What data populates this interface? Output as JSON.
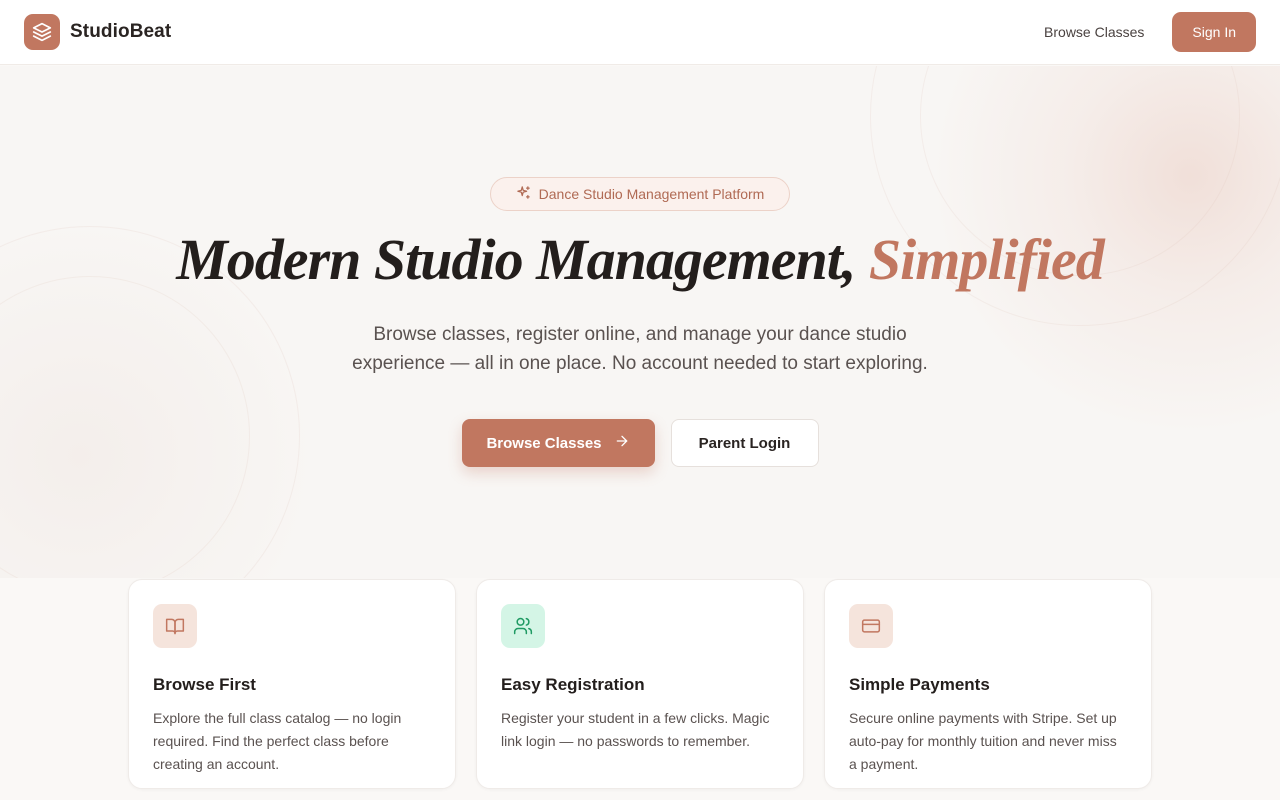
{
  "header": {
    "brand_name": "StudioBeat",
    "nav_browse": "Browse Classes",
    "sign_in": "Sign In"
  },
  "hero": {
    "badge": "Dance Studio Management Platform",
    "title_main": "Modern Studio Management,",
    "title_accent": "Simplified",
    "subtitle": "Browse classes, register online, and manage your dance studio experience — all in one place. No account needed to start exploring.",
    "primary_button": "Browse Classes",
    "secondary_button": "Parent Login"
  },
  "features": [
    {
      "icon": "book-open-icon",
      "title": "Browse First",
      "text": "Explore the full class catalog — no login required. Find the perfect class before creating an account."
    },
    {
      "icon": "users-icon",
      "title": "Easy Registration",
      "text": "Register your student in a few clicks. Magic link login — no passwords to remember."
    },
    {
      "icon": "credit-card-icon",
      "title": "Simple Payments",
      "text": "Secure online payments with Stripe. Set up auto-pay for monthly tuition and never miss a payment."
    }
  ],
  "colors": {
    "accent": "#c17760",
    "accent_soft": "#f5e4dc",
    "mint_soft": "#d4f5e6",
    "mint_icon": "#1f9a63",
    "text_dark": "#231e1c"
  }
}
